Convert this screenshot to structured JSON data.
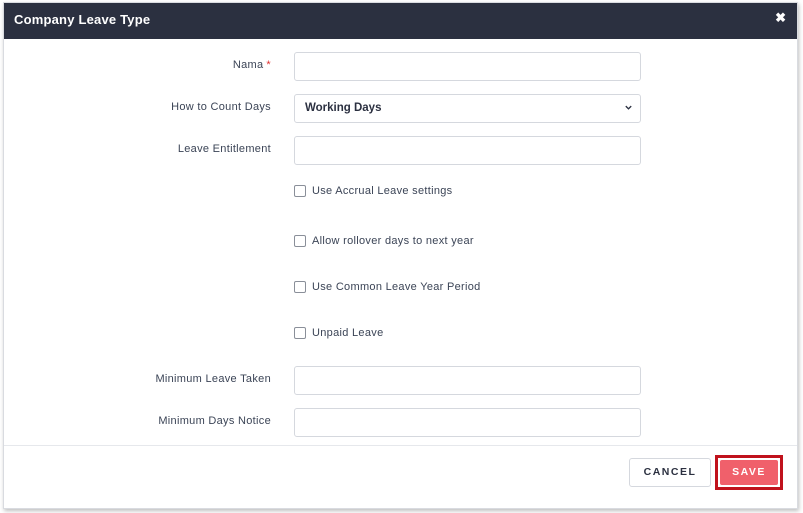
{
  "modal": {
    "title": "Company Leave Type",
    "close_icon": "close-icon"
  },
  "form": {
    "name": {
      "label": "Nama",
      "required_marker": "*",
      "value": ""
    },
    "count_days": {
      "label": "How to Count Days",
      "selected": "Working Days",
      "icon": "chevron-down-icon"
    },
    "entitlement": {
      "label": "Leave Entitlement",
      "value": ""
    },
    "checkboxes": [
      {
        "label": "Use Accrual Leave settings",
        "checked": false
      },
      {
        "label": "Allow rollover days to next year",
        "checked": false
      },
      {
        "label": "Use Common Leave Year Period",
        "checked": false
      },
      {
        "label": "Unpaid Leave",
        "checked": false
      }
    ],
    "min_leave_taken": {
      "label": "Minimum Leave Taken",
      "value": ""
    },
    "min_days_notice": {
      "label": "Minimum Days Notice",
      "value": ""
    }
  },
  "footer": {
    "cancel_label": "CANCEL",
    "save_label": "SAVE"
  },
  "colors": {
    "header_bg": "#2b3040",
    "save_bg": "#f0606b",
    "highlight_border": "#c0121c",
    "required": "#e0302f"
  }
}
